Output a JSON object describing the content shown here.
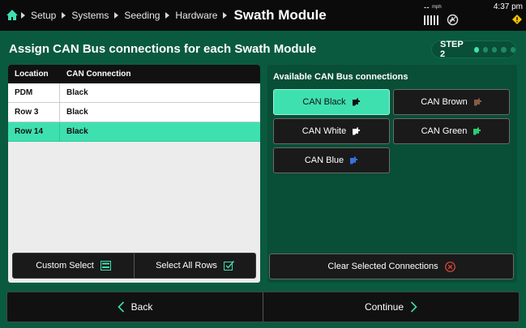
{
  "header": {
    "breadcrumbs": [
      "Setup",
      "Systems",
      "Seeding",
      "Hardware"
    ],
    "title": "Swath Module",
    "speed_value": "--",
    "speed_unit": "mph",
    "time": "4:37 pm"
  },
  "page": {
    "heading": "Assign CAN Bus connections for each Swath Module",
    "step_label": "STEP 2",
    "step_total": 5,
    "step_active": 1
  },
  "table": {
    "columns": [
      "Location",
      "CAN Connection"
    ],
    "rows": [
      {
        "location": "PDM",
        "connection": "Black"
      },
      {
        "location": "Row 3",
        "connection": "Black"
      },
      {
        "location": "Row 14",
        "connection": "Black"
      }
    ],
    "selected_row": 2
  },
  "left_actions": {
    "custom_select": "Custom Select",
    "select_all": "Select All Rows"
  },
  "connections": {
    "title": "Available CAN Bus connections",
    "items": [
      {
        "label": "CAN Black",
        "color": "#111111",
        "selected": true
      },
      {
        "label": "CAN Brown",
        "color": "#8a5a44",
        "selected": false
      },
      {
        "label": "CAN White",
        "color": "#ffffff",
        "selected": false
      },
      {
        "label": "CAN Green",
        "color": "#2ecc71",
        "selected": false
      },
      {
        "label": "CAN Blue",
        "color": "#3a6fe0",
        "selected": false
      }
    ],
    "clear_label": "Clear Selected Connections"
  },
  "nav": {
    "back": "Back",
    "continue": "Continue"
  },
  "colors": {
    "accent": "#3ee0b0",
    "background": "#0a5a3f",
    "warning": "#f2c400",
    "clear_icon": "#e04a3a"
  }
}
